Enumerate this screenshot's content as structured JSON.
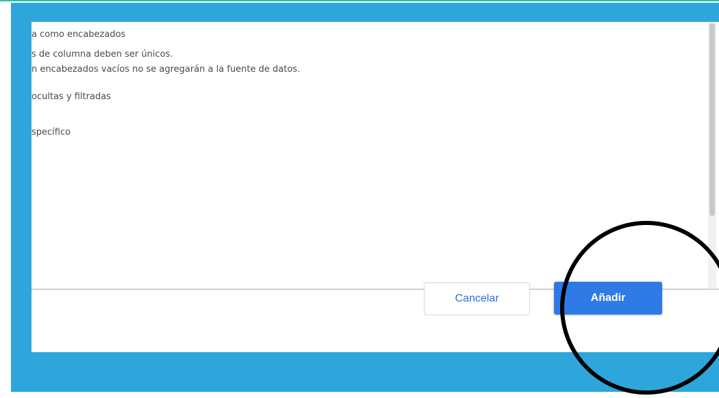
{
  "dialog": {
    "options": [
      "a como encabezados",
      "s de columna deben ser únicos.",
      "n encabezados vacíos no se agregarán a la fuente de datos.",
      "ocultas y filtradas",
      "specífico"
    ]
  },
  "footer": {
    "cancel_label": "Cancelar",
    "add_label": "Añadir"
  },
  "colors": {
    "frame": "#2ea6dc",
    "primary_button": "#2e7ae6",
    "cancel_text": "#2b6fe1",
    "annotation_circle": "#000000"
  },
  "annotation": {
    "icon": "highlight-circle-icon"
  }
}
